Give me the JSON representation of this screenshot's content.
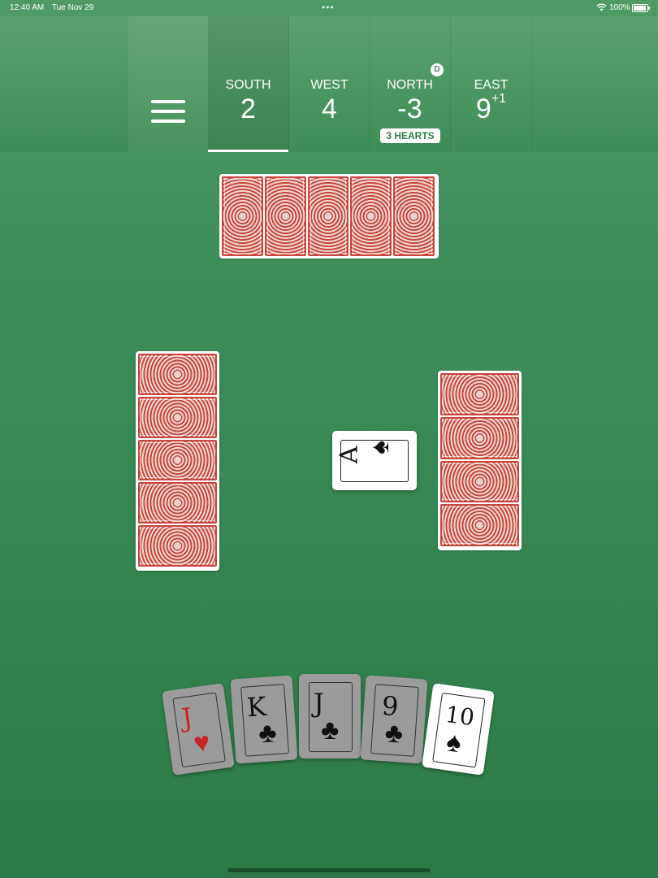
{
  "status_bar": {
    "time": "12:40 AM",
    "date": "Tue Nov 29",
    "battery": "100%"
  },
  "scoreboard": {
    "players": [
      {
        "name": "SOUTH",
        "score": "2",
        "bonus": ""
      },
      {
        "name": "WEST",
        "score": "4",
        "bonus": ""
      },
      {
        "name": "NORTH",
        "score": "-3",
        "bonus": "",
        "dealer": "D",
        "bid": "3 HEARTS"
      },
      {
        "name": "EAST",
        "score": "9",
        "bonus": "+1"
      }
    ]
  },
  "table": {
    "north_cards_remaining": 5,
    "west_cards_remaining": 5,
    "east_cards_remaining": 4,
    "played_card": {
      "rank": "A",
      "suit": "♠"
    }
  },
  "hand": [
    {
      "rank": "J",
      "suit": "♥",
      "color": "#c62626",
      "playable": false
    },
    {
      "rank": "K",
      "suit": "♣",
      "color": "#111111",
      "playable": false
    },
    {
      "rank": "J",
      "suit": "♣",
      "color": "#111111",
      "playable": false
    },
    {
      "rank": "9",
      "suit": "♣",
      "color": "#111111",
      "playable": false
    },
    {
      "rank": "10",
      "suit": "♠",
      "color": "#111111",
      "playable": true
    }
  ]
}
